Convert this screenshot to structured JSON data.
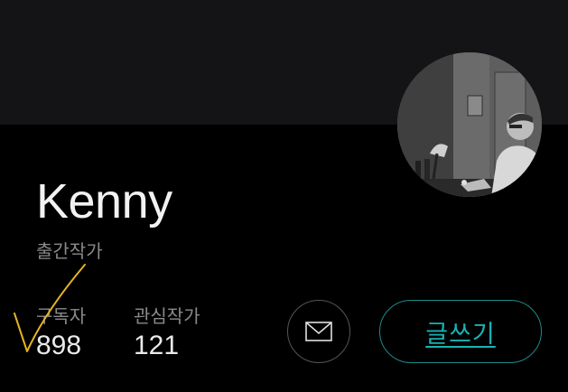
{
  "profile": {
    "name": "Kenny",
    "role": "출간작가",
    "avatar_icon": "profile-photo"
  },
  "stats": {
    "subscribers_label": "구독자",
    "subscribers_value": "898",
    "following_label": "관심작가",
    "following_value": "121"
  },
  "actions": {
    "mail_icon": "envelope-icon",
    "write_label": "글쓰기"
  },
  "colors": {
    "background": "#000000",
    "cover": "#141416",
    "accent": "#19b3b3",
    "annotation": "#e6b422"
  }
}
